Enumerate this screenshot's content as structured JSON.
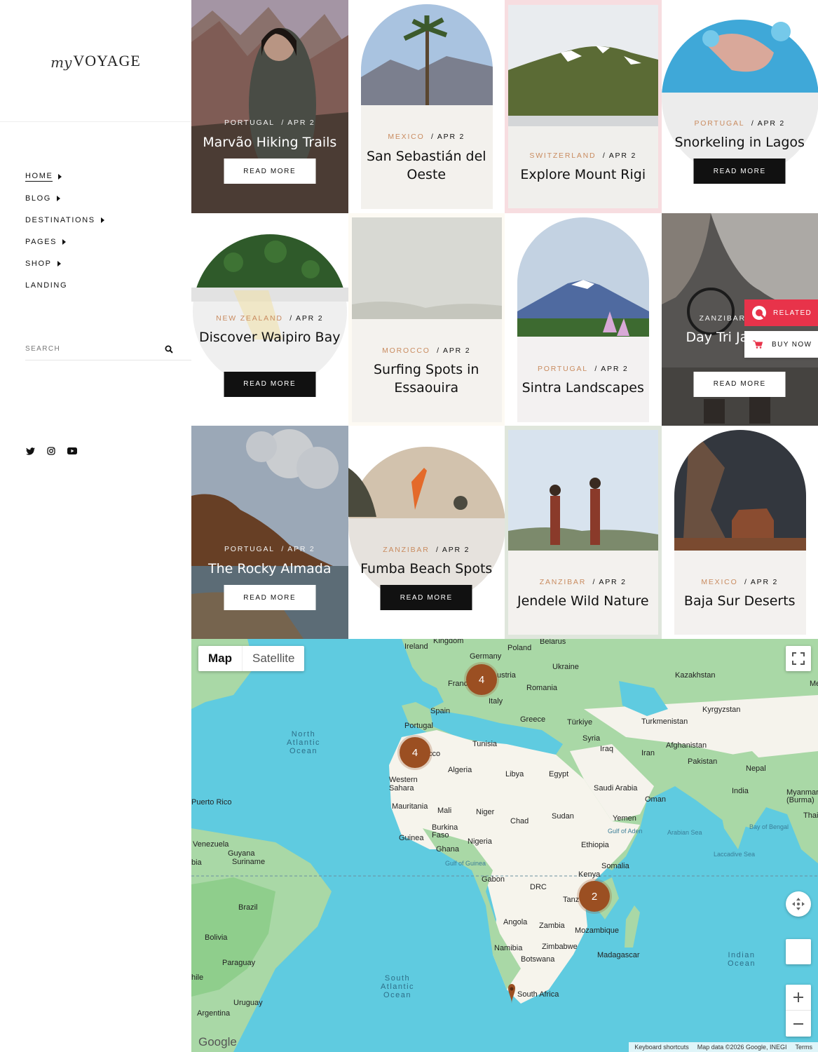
{
  "brand": {
    "prefix": "my",
    "name": "VOYAGE"
  },
  "nav": [
    {
      "label": "HOME",
      "has_caret": true,
      "active": true
    },
    {
      "label": "BLOG",
      "has_caret": true
    },
    {
      "label": "DESTINATIONS",
      "has_caret": true
    },
    {
      "label": "PAGES",
      "has_caret": true
    },
    {
      "label": "SHOP",
      "has_caret": true
    },
    {
      "label": "LANDING",
      "has_caret": false
    }
  ],
  "search": {
    "placeholder": "SEARCH",
    "icon": "search-icon"
  },
  "socials": [
    "twitter-icon",
    "instagram-icon",
    "youtube-icon"
  ],
  "read_more": "READ MORE",
  "posts": [
    {
      "country": "PORTUGAL",
      "date": "/ APR 2",
      "title": "Marvão Hiking Trails"
    },
    {
      "country": "MEXICO",
      "date": "/ APR 2",
      "title": "San Sebastián del Oeste"
    },
    {
      "country": "SWITZERLAND",
      "date": "/ APR 2",
      "title": "Explore Mount Rigi"
    },
    {
      "country": "PORTUGAL",
      "date": "/ APR 2",
      "title": "Snorkeling in Lagos"
    },
    {
      "country": "NEW ZEALAND",
      "date": "/ APR 2",
      "title": "Discover Waipiro Bay"
    },
    {
      "country": "MOROCCO",
      "date": "/ APR 2",
      "title": "Surfing Spots in Essaouira"
    },
    {
      "country": "PORTUGAL",
      "date": "/ APR 2",
      "title": "Sintra Landscapes"
    },
    {
      "country": "ZANZIBAR",
      "date": "",
      "title": "Day Tri Jambiani"
    },
    {
      "country": "PORTUGAL",
      "date": "/ APR 2",
      "title": "The Rocky Almada"
    },
    {
      "country": "ZANZIBAR",
      "date": "/ APR 2",
      "title": "Fumba Beach Spots"
    },
    {
      "country": "ZANZIBAR",
      "date": "/ APR 2",
      "title": "Jendele Wild Nature"
    },
    {
      "country": "MEXICO",
      "date": "/ APR 2",
      "title": "Baja Sur Deserts"
    }
  ],
  "floating": {
    "related": "RELATED",
    "buy_now": "BUY NOW"
  },
  "map": {
    "type_buttons": {
      "map": "Map",
      "satellite": "Satellite"
    },
    "clusters": [
      "4",
      "4",
      "2"
    ],
    "countries": [
      "Ireland",
      "Kingdom",
      "Poland",
      "Belarus",
      "Germany",
      "Ukraine",
      "Kazakhstan",
      "ustria",
      "Franc",
      "Romania",
      "Italy",
      "Spain",
      "Portugal",
      "Greece",
      "Türkiye",
      "Turkmenistan",
      "Kyrgyzstan",
      "Syria",
      "Tunisia",
      "Afghanistan",
      "Iraq",
      "Iran",
      "Pakistan",
      "Nepal",
      "cco",
      "Algeria",
      "Libya",
      "Egypt",
      "Western Sahara",
      "Saudi Arabia",
      "India",
      "Oman",
      "Myanmar (Burma)",
      "Mauritania",
      "Mali",
      "Niger",
      "Chad",
      "Sudan",
      "Yemen",
      "Thai",
      "Burkina Faso",
      "Guinea",
      "Nigeria",
      "Ethiopia",
      "Ghana",
      "Somalia",
      "Kenya",
      "Gabon",
      "DRC",
      "Tanz",
      "Angola",
      "Zambia",
      "Mozambique",
      "Namibia",
      "Zimbabwe",
      "Botswana",
      "Madagascar",
      "South Africa",
      "Puerto Rico",
      "Venezuela",
      "Guyana",
      "Suriname",
      "Brazil",
      "Bolivia",
      "Paraguay",
      "Uruguay",
      "Argentina",
      "hile",
      "bia",
      "Me"
    ],
    "oceans": [
      "North Atlantic Ocean",
      "South Atlantic Ocean",
      "Indian Ocean"
    ],
    "seas": [
      "Arabian Sea",
      "Bay of Bengal",
      "Laccadive Sea",
      "Gulf of Aden",
      "Gulf of Guinea"
    ],
    "attribution": {
      "shortcuts": "Keyboard shortcuts",
      "data": "Map data ©2026 Google, INEGI",
      "terms": "Terms"
    },
    "google": "Google"
  }
}
